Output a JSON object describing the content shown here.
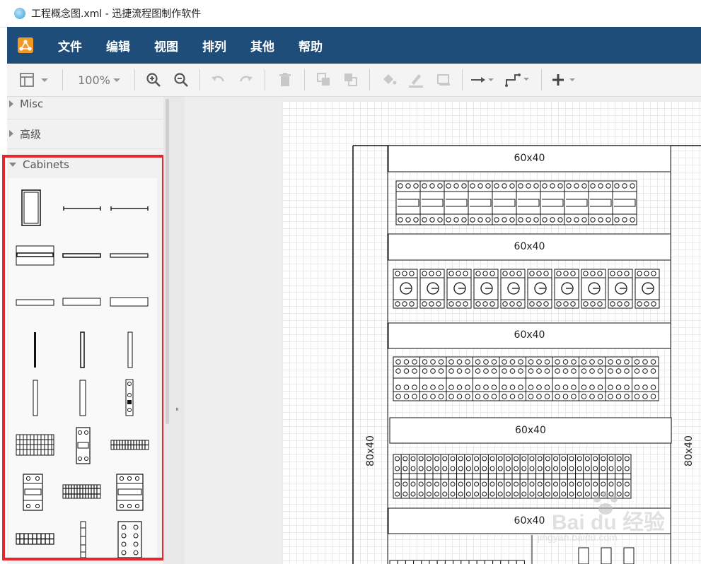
{
  "window": {
    "title": "工程概念图.xml - 迅捷流程图制作软件"
  },
  "menu": [
    "文件",
    "编辑",
    "视图",
    "排列",
    "其他",
    "帮助"
  ],
  "toolbar": {
    "zoom": "100%",
    "icons": [
      "format-panel-icon",
      "zoom-in-icon",
      "zoom-out-icon",
      "undo-icon",
      "redo-icon",
      "delete-icon",
      "to-front-icon",
      "to-back-icon",
      "fill-color-icon",
      "line-color-icon",
      "shadow-icon",
      "connection-icon",
      "waypoints-icon",
      "insert-icon"
    ]
  },
  "sidebar": {
    "sections": [
      {
        "label": "Misc",
        "expanded": false
      },
      {
        "label": "高级",
        "expanded": false
      },
      {
        "label": "Cabinets",
        "expanded": true
      }
    ]
  },
  "diagram": {
    "side_label_left": "80x40",
    "side_label_right": "80x40",
    "trunking_labels": [
      "60x40",
      "60x40",
      "60x40",
      "60x40",
      "60x40"
    ]
  },
  "watermark": {
    "text": "Bai du 经验",
    "subtext": "jingyan.baidu.com"
  },
  "colors": {
    "menubar": "#1e4d79",
    "logo": "#f29a25",
    "highlight": "#e8262d"
  }
}
